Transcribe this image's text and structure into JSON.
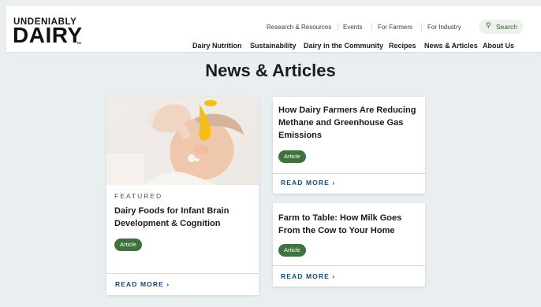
{
  "header": {
    "logo_top": "UNDENIABLY",
    "logo_main": "DAIRY",
    "logo_tm": "TM",
    "utility_links": [
      "Research & Resources",
      "Events",
      "For Farmers",
      "For Industry"
    ],
    "search_label": "Search",
    "nav": [
      "Dairy Nutrition",
      "Sustainability",
      "Dairy in the Community",
      "Recipes",
      "News & Articles",
      "About Us"
    ]
  },
  "main": {
    "page_title": "News & Articles",
    "featured": {
      "kicker": "FEATURED",
      "title": "Dairy Foods for Infant Brain Development & Cognition",
      "badge": "Article",
      "read_more": "READ MORE ›"
    },
    "articles": [
      {
        "title": "How Dairy Farmers Are Reducing Methane and Greenhouse Gas Emissions",
        "badge": "Article",
        "read_more": "READ MORE ›"
      },
      {
        "title": "Farm to Table: How Milk Goes From the Cow to Your Home",
        "badge": "Article",
        "read_more": "READ MORE ›"
      }
    ]
  },
  "colors": {
    "badge": "#3e733d",
    "read_more": "#174b77",
    "search_bg": "#eef2ed",
    "background": "#e9eef0"
  },
  "icons": [
    "search-icon",
    "chevron-right-icon"
  ]
}
